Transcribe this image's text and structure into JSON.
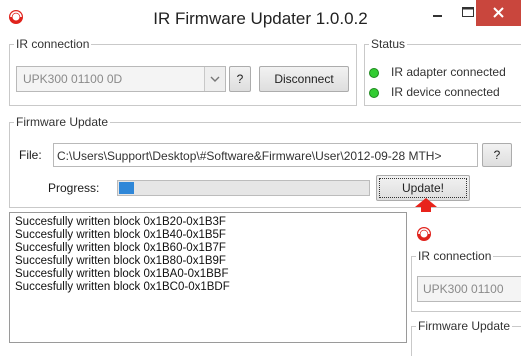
{
  "window": {
    "title": "IR Firmware Updater 1.0.0.2",
    "app_icon": "updater-logo-icon",
    "controls": [
      "minimize-icon",
      "maximize-icon",
      "close-icon"
    ],
    "close_color": "#c9463d"
  },
  "ir_connection": {
    "legend": "IR connection",
    "port_value": "UPK300  01100 0D",
    "help_label": "?",
    "disconnect_label": "Disconnect"
  },
  "status": {
    "legend": "Status",
    "items": [
      {
        "label": "IR adapter connected",
        "color": "#33cc33"
      },
      {
        "label": "IR device connected",
        "color": "#33cc33"
      }
    ]
  },
  "firmware_update": {
    "legend": "Firmware Update",
    "file_label": "File:",
    "file_path": "C:\\Users\\Support\\Desktop\\#Software&Firmware\\User\\2012-09-28 MTH>",
    "help_label": "?",
    "progress_label": "Progress:",
    "progress_fraction": 0.06,
    "progress_color": "#2f87d8",
    "update_label": "Update!"
  },
  "log": {
    "lines": [
      "Succesfully written block 0x1B20-0x1B3F",
      "Succesfully written block 0x1B40-0x1B5F",
      "Succesfully written block 0x1B60-0x1B7F",
      "Succesfully written block 0x1B80-0x1B9F",
      "Succesfully written block 0x1BA0-0x1BBF",
      "Succesfully written block 0x1BC0-0x1BDF"
    ]
  },
  "annotation": {
    "arrow_color": "#e8231b"
  },
  "overlay_window": {
    "app_icon": "updater-logo-icon",
    "ir_connection_legend": "IR connection",
    "port_value": "UPK300  01100",
    "firmware_update_legend": "Firmware Update"
  }
}
